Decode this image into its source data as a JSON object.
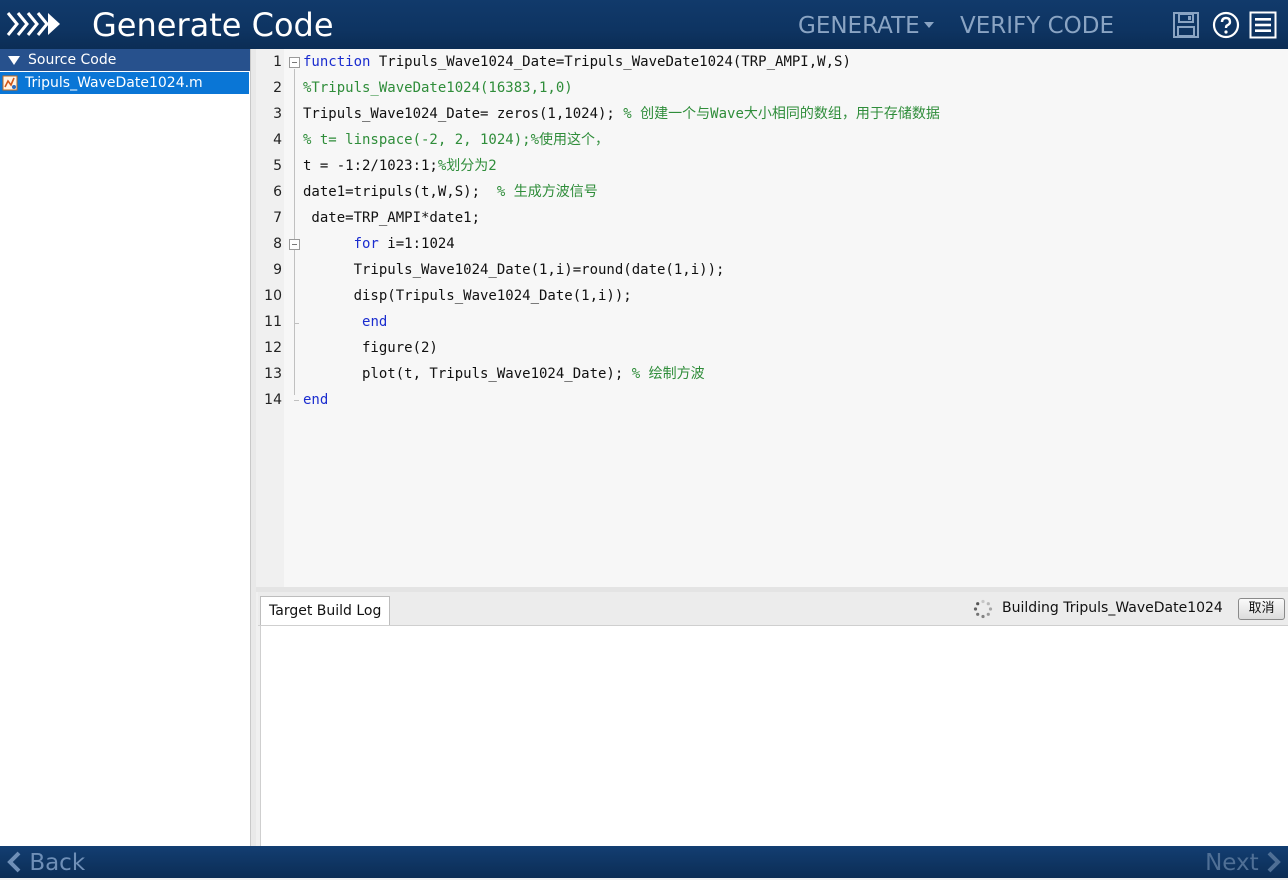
{
  "header": {
    "title": "Generate Code",
    "generate_label": "GENERATE",
    "verify_label": "VERIFY CODE"
  },
  "sidebar": {
    "section_label": "Source Code",
    "file_label": "Tripuls_WaveDate1024.m"
  },
  "editor": {
    "lines": [
      {
        "n": "1",
        "segments": [
          {
            "t": "function",
            "k": "kw"
          },
          {
            "t": " Tripuls_Wave1024_Date=Tripuls_WaveDate1024(TRP_AMPI,W,S)",
            "k": ""
          }
        ]
      },
      {
        "n": "2",
        "segments": [
          {
            "t": "%Tripuls_WaveDate1024(16383,1,0)",
            "k": "cm"
          }
        ]
      },
      {
        "n": "3",
        "segments": [
          {
            "t": "Tripuls_Wave1024_Date= zeros(1,1024); ",
            "k": ""
          },
          {
            "t": "% 创建一个与Wave大小相同的数组，用于存储数据",
            "k": "cm"
          }
        ]
      },
      {
        "n": "4",
        "segments": [
          {
            "t": "% t= linspace(-2, 2, 1024);%使用这个，",
            "k": "cm"
          }
        ]
      },
      {
        "n": "5",
        "segments": [
          {
            "t": "t = -1:2/1023:1;",
            "k": ""
          },
          {
            "t": "%划分为2",
            "k": "cm"
          }
        ]
      },
      {
        "n": "6",
        "segments": [
          {
            "t": "date1=tripuls(t,W,S);  ",
            "k": ""
          },
          {
            "t": "% 生成方波信号",
            "k": "cm"
          }
        ]
      },
      {
        "n": "7",
        "segments": [
          {
            "t": " date=TRP_AMPI*date1;",
            "k": ""
          }
        ]
      },
      {
        "n": "8",
        "segments": [
          {
            "t": "      ",
            "k": ""
          },
          {
            "t": "for",
            "k": "kw"
          },
          {
            "t": " i=1:1024",
            "k": ""
          }
        ]
      },
      {
        "n": "9",
        "segments": [
          {
            "t": "      Tripuls_Wave1024_Date(1,i)=round(date(1,i));",
            "k": ""
          }
        ]
      },
      {
        "n": "10",
        "segments": [
          {
            "t": "      disp(Tripuls_Wave1024_Date(1,i));",
            "k": ""
          }
        ]
      },
      {
        "n": "11",
        "segments": [
          {
            "t": "       ",
            "k": ""
          },
          {
            "t": "end",
            "k": "kw"
          }
        ]
      },
      {
        "n": "12",
        "segments": [
          {
            "t": "       figure(2)",
            "k": ""
          }
        ]
      },
      {
        "n": "13",
        "segments": [
          {
            "t": "       plot(t, Tripuls_Wave1024_Date); ",
            "k": ""
          },
          {
            "t": "% 绘制方波",
            "k": "cm"
          }
        ]
      },
      {
        "n": "14",
        "segments": [
          {
            "t": "end",
            "k": "kw"
          }
        ]
      }
    ]
  },
  "log": {
    "tab_label": "Target Build Log",
    "status_text": "Building Tripuls_WaveDate1024",
    "cancel_label": "取消"
  },
  "footer": {
    "back_label": "Back",
    "next_label": "Next"
  },
  "colors": {
    "header_bg": "#0e3462",
    "selected_item": "#0a76d6",
    "section_header": "#27518d",
    "keyword": "#1b2dcf",
    "comment": "#2f8d3a"
  },
  "icons": {
    "logo": "chevrons-logo-icon",
    "save": "save-icon",
    "help": "help-icon",
    "menu": "hamburger-menu-icon",
    "spinner": "loading-spinner-icon"
  }
}
